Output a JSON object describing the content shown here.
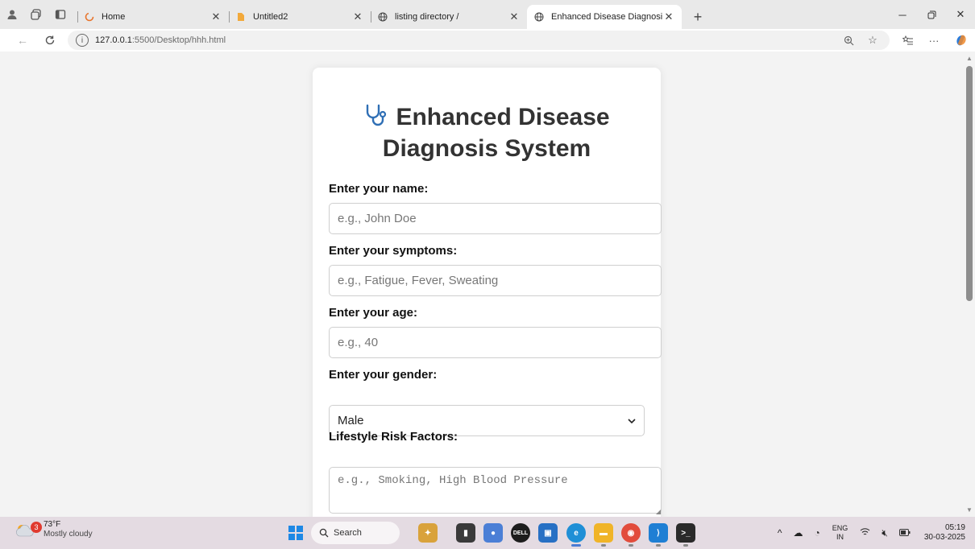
{
  "browser": {
    "tabs": [
      {
        "label": "Home",
        "favicon": "loading-ring-icon",
        "active": false
      },
      {
        "label": "Untitled2",
        "favicon": "document-icon",
        "active": false
      },
      {
        "label": "listing directory /",
        "favicon": "globe-icon",
        "active": false
      },
      {
        "label": "Enhanced Disease Diagnosis Syst",
        "favicon": "globe-icon",
        "active": true
      }
    ],
    "url_host": "127.0.0.1",
    "url_path": ":5500/Desktop/hhh.html"
  },
  "page": {
    "title": "Enhanced Disease Diagnosis System",
    "name_label": "Enter your name:",
    "name_placeholder": "e.g., John Doe",
    "symptoms_label": "Enter your symptoms:",
    "symptoms_placeholder": "e.g., Fatigue, Fever, Sweating",
    "age_label": "Enter your age:",
    "age_placeholder": "e.g., 40",
    "gender_label": "Enter your gender:",
    "gender_value": "Male",
    "lifestyle_label": "Lifestyle Risk Factors:",
    "lifestyle_placeholder": "e.g., Smoking, High Blood Pressure",
    "accent_color": "#1a73c9"
  },
  "taskbar": {
    "weather_temp": "73°F",
    "weather_condition": "Mostly cloudy",
    "weather_badge": "3",
    "search_label": "Search",
    "lang_primary": "ENG",
    "lang_secondary": "IN",
    "time": "05:19",
    "date": "30-03-2025"
  }
}
